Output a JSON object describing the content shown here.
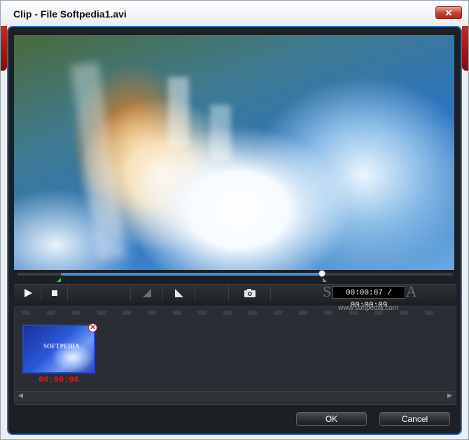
{
  "window": {
    "title": "Clip - File Softpedia1.avi",
    "close_label": "✕"
  },
  "player": {
    "timecode": "00:00:07 / 00:00:09",
    "progress_fraction": 0.7
  },
  "watermark": {
    "text": "SOFTPEDIA",
    "url": "www.softpedia.com"
  },
  "clips": [
    {
      "time": "00:00:06",
      "logo": "SOFTPEDIA"
    }
  ],
  "buttons": {
    "ok": "OK",
    "cancel": "Cancel"
  },
  "icons": {
    "play": "play-icon",
    "stop": "stop-icon",
    "mark_in": "mark-in-icon",
    "mark_out": "mark-out-icon",
    "snapshot": "camera-icon",
    "remove": "remove-icon"
  }
}
